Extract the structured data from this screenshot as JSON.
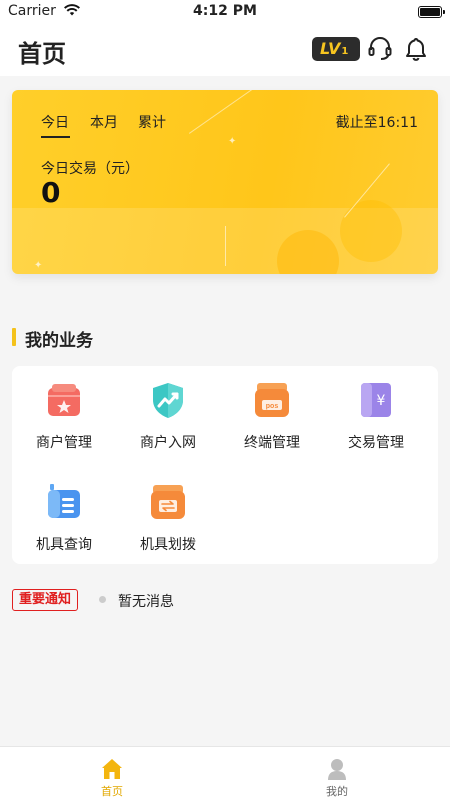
{
  "status_bar": {
    "carrier": "Carrier",
    "time": "4:12 PM"
  },
  "header": {
    "title": "首页",
    "level_badge": "LV",
    "level_number": "1"
  },
  "stats_card": {
    "tabs": [
      {
        "label": "今日"
      },
      {
        "label": "本月"
      },
      {
        "label": "累计"
      }
    ],
    "as_of": "截止至16:11",
    "metric_label": "今日交易（元）",
    "metric_value": "0"
  },
  "business": {
    "title": "我的业务",
    "items": [
      {
        "label": "商户管理",
        "icon": "merchant-store-icon"
      },
      {
        "label": "商户入网",
        "icon": "merchant-onboard-shield-icon"
      },
      {
        "label": "终端管理",
        "icon": "pos-terminal-icon"
      },
      {
        "label": "交易管理",
        "icon": "transaction-yuan-icon"
      },
      {
        "label": "机具查询",
        "icon": "device-query-icon"
      },
      {
        "label": "机具划拨",
        "icon": "device-transfer-icon"
      }
    ]
  },
  "notice": {
    "badge": "重要通知",
    "text": "暂无消息"
  },
  "tabbar": {
    "items": [
      {
        "label": "首页",
        "icon": "home-icon"
      },
      {
        "label": "我的",
        "icon": "profile-icon"
      }
    ]
  },
  "colors": {
    "accent": "#ffc61a",
    "notice_red": "#e02020",
    "tab_active": "#e2a800"
  }
}
